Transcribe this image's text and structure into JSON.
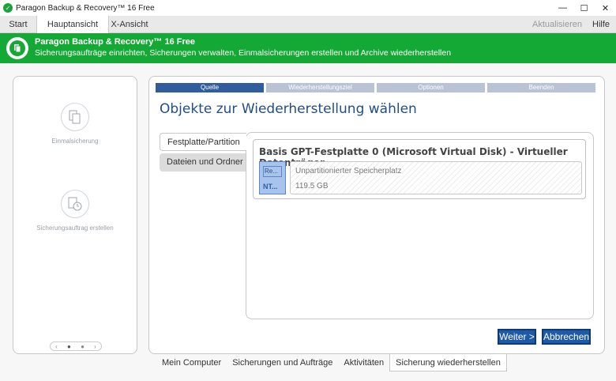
{
  "window": {
    "title": "Paragon Backup & Recovery™ 16 Free",
    "controls": {
      "minimize": "—",
      "maximize": "☐",
      "close": "✕"
    }
  },
  "menu": {
    "tabs": [
      "Start",
      "Hauptansicht",
      "X-Ansicht"
    ],
    "active_tab": "Hauptansicht",
    "refresh_label": "Aktualisieren",
    "help_label": "Hilfe"
  },
  "header": {
    "title": "Paragon Backup & Recovery™ 16 Free",
    "subtitle": "Sicherungsaufträge einrichten, Sicherungen verwalten, Einmalsicherungen erstellen und Archive wiederherstellen",
    "icon": "paragon-logo-icon"
  },
  "left_panel": {
    "items": [
      {
        "label": "Einmalsicherung",
        "icon": "document-copy-icon"
      },
      {
        "label": "Sicherungsauftrag erstellen",
        "icon": "scheduled-backup-icon"
      }
    ],
    "pager": {
      "prev": "‹",
      "next": "›"
    }
  },
  "wizard": {
    "steps": [
      "Quelle",
      "Wiederherstellungsziel",
      "Optionen",
      "Beenden"
    ],
    "active_step": "Quelle",
    "title": "Objekte zur Wiederherstellung wählen",
    "source_tabs": [
      "Festplatte/Partition",
      "Dateien und Ordner"
    ],
    "active_source_tab": "Festplatte/Partition",
    "disk": {
      "title": "Basis GPT-Festplatte 0 (Microsoft Virtual Disk) - Virtueller Datenträger",
      "chip_label": "Re...",
      "chip_fs": "NT...",
      "unallocated_label": "Unpartitionierter Speicherplatz",
      "unallocated_size": "119.5 GB"
    },
    "next_label": "Weiter >",
    "cancel_label": "Abbrechen"
  },
  "bottom_tabs": [
    "Mein Computer",
    "Sicherungen und Aufträge",
    "Aktivitäten",
    "Sicherung wiederherstellen"
  ],
  "active_bottom_tab": "Sicherung wiederherstellen",
  "colors": {
    "brand_green": "#14a834",
    "step_active": "#2f5d9e",
    "step_inactive": "#b8c4d6",
    "title_blue": "#1f4e88",
    "button_blue": "#1f5aa6"
  }
}
